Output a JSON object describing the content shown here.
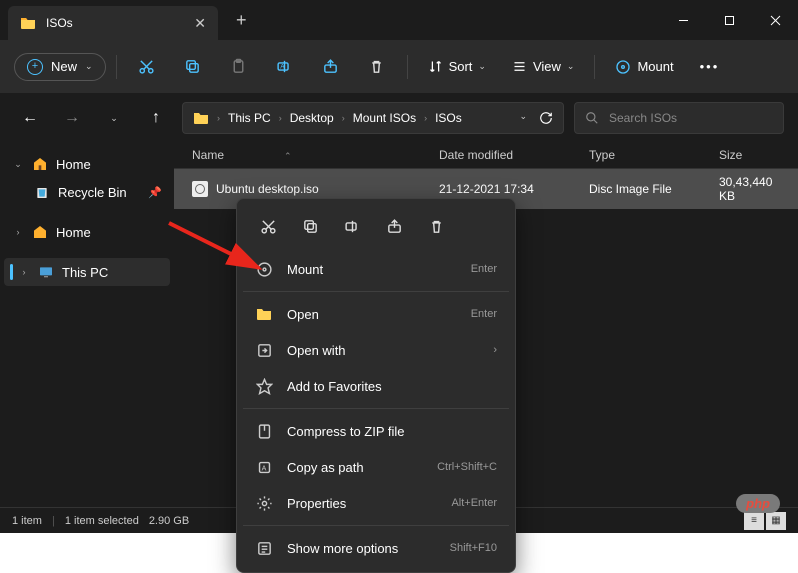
{
  "titlebar": {
    "tab_title": "ISOs"
  },
  "toolbar": {
    "new_label": "New",
    "sort_label": "Sort",
    "view_label": "View",
    "mount_label": "Mount"
  },
  "breadcrumb": [
    "This PC",
    "Desktop",
    "Mount ISOs",
    "ISOs"
  ],
  "search": {
    "placeholder": "Search ISOs"
  },
  "sidebar": {
    "home": "Home",
    "recycle": "Recycle Bin",
    "home2": "Home",
    "thispc": "This PC"
  },
  "columns": {
    "name": "Name",
    "date": "Date modified",
    "type": "Type",
    "size": "Size"
  },
  "files": [
    {
      "name": "Ubuntu desktop.iso",
      "date": "21-12-2021 17:34",
      "type": "Disc Image File",
      "size": "30,43,440 KB"
    }
  ],
  "status": {
    "count": "1 item",
    "selected": "1 item selected",
    "size": "2.90 GB"
  },
  "context_menu": {
    "mount": {
      "label": "Mount",
      "hint": "Enter"
    },
    "open": {
      "label": "Open",
      "hint": "Enter"
    },
    "open_with": {
      "label": "Open with"
    },
    "favorites": {
      "label": "Add to Favorites"
    },
    "compress": {
      "label": "Compress to ZIP file"
    },
    "copy_path": {
      "label": "Copy as path",
      "hint": "Ctrl+Shift+C"
    },
    "properties": {
      "label": "Properties",
      "hint": "Alt+Enter"
    },
    "more": {
      "label": "Show more options",
      "hint": "Shift+F10"
    }
  },
  "watermark": {
    "brand_colored": "php",
    "brand_rest": ""
  }
}
